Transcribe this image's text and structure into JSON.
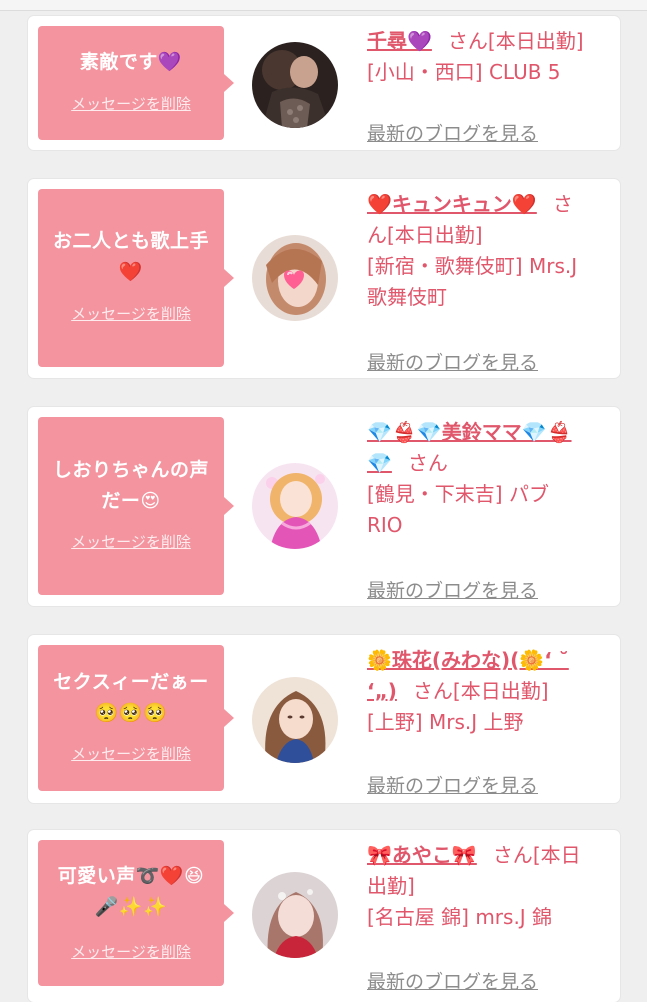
{
  "entries": [
    {
      "message": "素敵です💜",
      "delete_label": "メッセージを削除",
      "name": "千尋💜",
      "san": "さん",
      "status": "[本日出勤]",
      "shop": "[小山・西口] CLUB 5",
      "blog_label": "最新のブログを見る",
      "avatar_icon": "cast-photo-dark-lace"
    },
    {
      "message": "お二人とも歌上手\n❤️",
      "delete_label": "メッセージを削除",
      "name": "❤️キュンキュン❤️",
      "san": "さ",
      "status": "ん[本日出勤]",
      "shop": "[新宿・歌舞伎町] Mrs.J\n歌舞伎町",
      "blog_label": "最新のブログを見る",
      "avatar_icon": "cast-photo-heart-sticker"
    },
    {
      "message": "しおりちゃんの声\nだー😍",
      "delete_label": "メッセージを削除",
      "name": "💎👙💎美鈴ママ💎👙\n💎",
      "san": "さん",
      "status": "",
      "shop": "[鶴見・下末吉] パブ\nRIO",
      "blog_label": "最新のブログを見る",
      "avatar_icon": "cast-photo-pink-dress"
    },
    {
      "message": "セクスィーだぁー\n🥺🥺🥺",
      "delete_label": "メッセージを削除",
      "name": "🌼珠花(みわな)(🌼‘ ˘\n‘„)",
      "san": "さん",
      "status": "[本日出勤]",
      "shop": "[上野] Mrs.J 上野",
      "blog_label": "最新のブログを見る",
      "avatar_icon": "cast-photo-long-hair"
    },
    {
      "message": "可愛い声➰❤️😆\n🎤✨✨",
      "delete_label": "メッセージを削除",
      "name": "🎀あやこ🎀",
      "san": "さん",
      "status": "[本日\n出勤]",
      "shop": "[名古屋 錦] mrs.J 錦",
      "blog_label": "最新のブログを見る",
      "avatar_icon": "cast-photo-red-dress"
    }
  ]
}
